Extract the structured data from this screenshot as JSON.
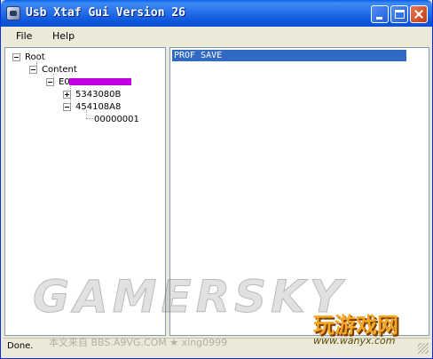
{
  "window": {
    "title": "Usb Xtaf Gui Version 26"
  },
  "menu": {
    "file": "File",
    "help": "Help"
  },
  "tree": {
    "root": "Root",
    "content": "Content",
    "device_prefix": "E0",
    "folder_1": "5343080B",
    "folder_2": "454108A8",
    "file_1": "00000001"
  },
  "list": {
    "selected_item": "PROF SAVE"
  },
  "status": {
    "text": "Done."
  },
  "watermark": {
    "main": "GAMERSKY",
    "source": "本文来自 BBS.A9VG.COM ★ xing0999",
    "logo": "玩游戏网",
    "logo_url": "www.wanyx.com"
  },
  "colors": {
    "selection": "#316ac5",
    "titlebar": "#0a56dc",
    "redaction": "#c000e0"
  }
}
